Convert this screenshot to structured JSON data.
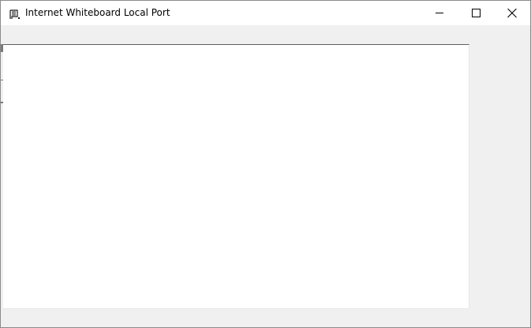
{
  "window": {
    "title": "Internet Whiteboard Local Port",
    "icon": "whiteboard-flag-icon"
  },
  "caption_buttons": {
    "minimize": "minimize-icon",
    "maximize": "maximize-icon",
    "close": "close-icon"
  },
  "colors": {
    "titlebar": "#ffffff",
    "client_background": "#f0f0f0",
    "canvas": "#ffffff",
    "window_border": "#8a8a8a"
  }
}
